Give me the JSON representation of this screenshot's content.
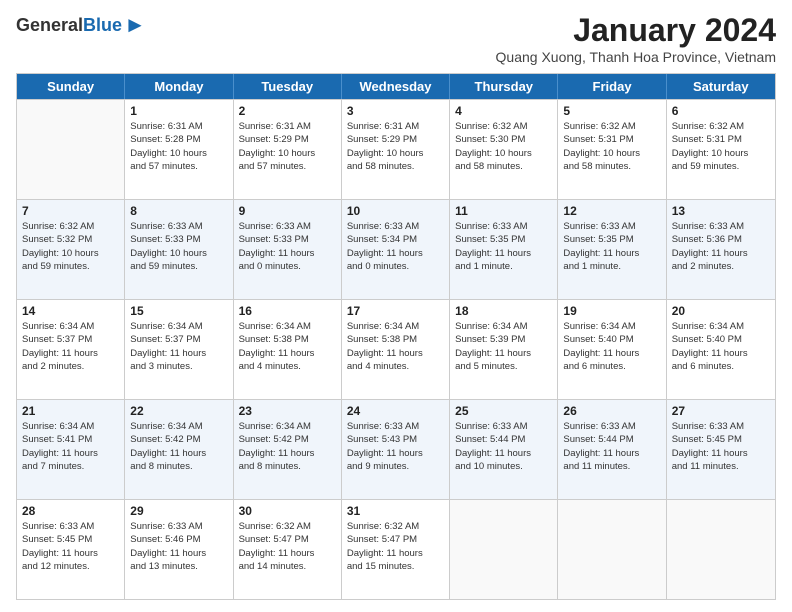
{
  "header": {
    "logo_general": "General",
    "logo_blue": "Blue",
    "title": "January 2024",
    "subtitle": "Quang Xuong, Thanh Hoa Province, Vietnam"
  },
  "days_of_week": [
    "Sunday",
    "Monday",
    "Tuesday",
    "Wednesday",
    "Thursday",
    "Friday",
    "Saturday"
  ],
  "weeks": [
    [
      {
        "num": "",
        "info": ""
      },
      {
        "num": "1",
        "info": "Sunrise: 6:31 AM\nSunset: 5:28 PM\nDaylight: 10 hours\nand 57 minutes."
      },
      {
        "num": "2",
        "info": "Sunrise: 6:31 AM\nSunset: 5:29 PM\nDaylight: 10 hours\nand 57 minutes."
      },
      {
        "num": "3",
        "info": "Sunrise: 6:31 AM\nSunset: 5:29 PM\nDaylight: 10 hours\nand 58 minutes."
      },
      {
        "num": "4",
        "info": "Sunrise: 6:32 AM\nSunset: 5:30 PM\nDaylight: 10 hours\nand 58 minutes."
      },
      {
        "num": "5",
        "info": "Sunrise: 6:32 AM\nSunset: 5:31 PM\nDaylight: 10 hours\nand 58 minutes."
      },
      {
        "num": "6",
        "info": "Sunrise: 6:32 AM\nSunset: 5:31 PM\nDaylight: 10 hours\nand 59 minutes."
      }
    ],
    [
      {
        "num": "7",
        "info": "Sunrise: 6:32 AM\nSunset: 5:32 PM\nDaylight: 10 hours\nand 59 minutes."
      },
      {
        "num": "8",
        "info": "Sunrise: 6:33 AM\nSunset: 5:33 PM\nDaylight: 10 hours\nand 59 minutes."
      },
      {
        "num": "9",
        "info": "Sunrise: 6:33 AM\nSunset: 5:33 PM\nDaylight: 11 hours\nand 0 minutes."
      },
      {
        "num": "10",
        "info": "Sunrise: 6:33 AM\nSunset: 5:34 PM\nDaylight: 11 hours\nand 0 minutes."
      },
      {
        "num": "11",
        "info": "Sunrise: 6:33 AM\nSunset: 5:35 PM\nDaylight: 11 hours\nand 1 minute."
      },
      {
        "num": "12",
        "info": "Sunrise: 6:33 AM\nSunset: 5:35 PM\nDaylight: 11 hours\nand 1 minute."
      },
      {
        "num": "13",
        "info": "Sunrise: 6:33 AM\nSunset: 5:36 PM\nDaylight: 11 hours\nand 2 minutes."
      }
    ],
    [
      {
        "num": "14",
        "info": "Sunrise: 6:34 AM\nSunset: 5:37 PM\nDaylight: 11 hours\nand 2 minutes."
      },
      {
        "num": "15",
        "info": "Sunrise: 6:34 AM\nSunset: 5:37 PM\nDaylight: 11 hours\nand 3 minutes."
      },
      {
        "num": "16",
        "info": "Sunrise: 6:34 AM\nSunset: 5:38 PM\nDaylight: 11 hours\nand 4 minutes."
      },
      {
        "num": "17",
        "info": "Sunrise: 6:34 AM\nSunset: 5:38 PM\nDaylight: 11 hours\nand 4 minutes."
      },
      {
        "num": "18",
        "info": "Sunrise: 6:34 AM\nSunset: 5:39 PM\nDaylight: 11 hours\nand 5 minutes."
      },
      {
        "num": "19",
        "info": "Sunrise: 6:34 AM\nSunset: 5:40 PM\nDaylight: 11 hours\nand 6 minutes."
      },
      {
        "num": "20",
        "info": "Sunrise: 6:34 AM\nSunset: 5:40 PM\nDaylight: 11 hours\nand 6 minutes."
      }
    ],
    [
      {
        "num": "21",
        "info": "Sunrise: 6:34 AM\nSunset: 5:41 PM\nDaylight: 11 hours\nand 7 minutes."
      },
      {
        "num": "22",
        "info": "Sunrise: 6:34 AM\nSunset: 5:42 PM\nDaylight: 11 hours\nand 8 minutes."
      },
      {
        "num": "23",
        "info": "Sunrise: 6:34 AM\nSunset: 5:42 PM\nDaylight: 11 hours\nand 8 minutes."
      },
      {
        "num": "24",
        "info": "Sunrise: 6:33 AM\nSunset: 5:43 PM\nDaylight: 11 hours\nand 9 minutes."
      },
      {
        "num": "25",
        "info": "Sunrise: 6:33 AM\nSunset: 5:44 PM\nDaylight: 11 hours\nand 10 minutes."
      },
      {
        "num": "26",
        "info": "Sunrise: 6:33 AM\nSunset: 5:44 PM\nDaylight: 11 hours\nand 11 minutes."
      },
      {
        "num": "27",
        "info": "Sunrise: 6:33 AM\nSunset: 5:45 PM\nDaylight: 11 hours\nand 11 minutes."
      }
    ],
    [
      {
        "num": "28",
        "info": "Sunrise: 6:33 AM\nSunset: 5:45 PM\nDaylight: 11 hours\nand 12 minutes."
      },
      {
        "num": "29",
        "info": "Sunrise: 6:33 AM\nSunset: 5:46 PM\nDaylight: 11 hours\nand 13 minutes."
      },
      {
        "num": "30",
        "info": "Sunrise: 6:32 AM\nSunset: 5:47 PM\nDaylight: 11 hours\nand 14 minutes."
      },
      {
        "num": "31",
        "info": "Sunrise: 6:32 AM\nSunset: 5:47 PM\nDaylight: 11 hours\nand 15 minutes."
      },
      {
        "num": "",
        "info": ""
      },
      {
        "num": "",
        "info": ""
      },
      {
        "num": "",
        "info": ""
      }
    ]
  ]
}
